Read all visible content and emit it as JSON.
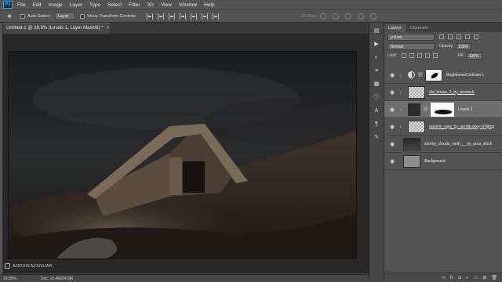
{
  "menubar": {
    "logo": "Ps",
    "items": [
      "File",
      "Edit",
      "Image",
      "Layer",
      "Type",
      "Select",
      "Filter",
      "3D",
      "View",
      "Window",
      "Help"
    ]
  },
  "options": {
    "auto_select_label": "Auto-Select:",
    "auto_select_value": "Layer",
    "transform_label": "Show Transform Controls",
    "mode3d_label": "3D Mode:"
  },
  "document": {
    "tab_title": "Untitled-1 @ 29.9% (Levels 1, Layer Mask/8) *",
    "tab_close": "×"
  },
  "watermark": {
    "text": "ANDHIKAZANUAR"
  },
  "status": {
    "zoom": "29.89%",
    "doc": "Doc: 15.4M/34.8M"
  },
  "layers_panel": {
    "tabs": [
      "Layers",
      "Channels"
    ],
    "kind": "ρ Kind",
    "blend_mode": "Normal",
    "opacity_label": "Opacity:",
    "opacity_value": "100%",
    "lock_label": "Lock:",
    "fill_label": "Fill:",
    "fill_value": "100%",
    "layers": [
      {
        "name": "Brightness/Contrast 1",
        "type": "adjustment",
        "clipped": true,
        "selected": false
      },
      {
        "name": "old_house_2_by_lesstack",
        "type": "image",
        "clipped": true,
        "selected": false
      },
      {
        "name": "Levels 1",
        "type": "levels",
        "clipped": true,
        "selected": true
      },
      {
        "name": "autumn_rays_by_acrobcokey-d7tjbnp",
        "type": "image",
        "clipped": true,
        "selected": false
      },
      {
        "name": "stormy_clouds_ninth___by_arca_stock",
        "type": "image",
        "clipped": false,
        "selected": false
      },
      {
        "name": "Background",
        "type": "background",
        "clipped": false,
        "selected": false
      }
    ],
    "footer_icons": [
      "link-icon",
      "fx-icon",
      "mask-icon",
      "adjustment-icon",
      "group-icon",
      "new-layer-icon",
      "trash-icon"
    ]
  },
  "colors": {
    "menubar": "#535353",
    "canvas_bg": "#282828",
    "panel_bg": "#535353",
    "selected_layer": "#6e6e6e",
    "ps_blue": "#31a8ff"
  }
}
